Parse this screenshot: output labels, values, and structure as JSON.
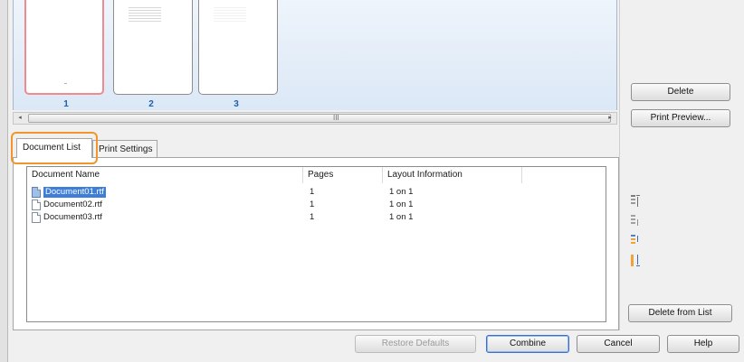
{
  "thumbnails": [
    {
      "number": "1",
      "selected": true
    },
    {
      "number": "2",
      "selected": false
    },
    {
      "number": "3",
      "selected": false
    }
  ],
  "preview_buttons": {
    "delete": "Delete",
    "print_preview": "Print Preview..."
  },
  "scrollbar": {
    "left_arrow": "◂",
    "grip": "III",
    "right_arrow": "▸"
  },
  "tabs": [
    {
      "label": "Document List",
      "active": true
    },
    {
      "label": "Print Settings",
      "active": false
    }
  ],
  "document_list": {
    "columns": [
      "Document Name",
      "Pages",
      "Layout Information"
    ],
    "rows": [
      {
        "name": "Document01.rtf",
        "pages": "1",
        "layout": "1 on 1",
        "selected": true
      },
      {
        "name": "Document02.rtf",
        "pages": "1",
        "layout": "1 on 1",
        "selected": false
      },
      {
        "name": "Document03.rtf",
        "pages": "1",
        "layout": "1 on 1",
        "selected": false
      }
    ]
  },
  "order_tools": [
    "move-to-top-icon",
    "move-up-icon",
    "move-down-icon",
    "move-to-bottom-icon"
  ],
  "list_buttons": {
    "delete_from_list": "Delete from List"
  },
  "footer_buttons": {
    "restore_defaults": "Restore Defaults",
    "combine": "Combine",
    "cancel": "Cancel",
    "help": "Help"
  },
  "colors": {
    "selection": "#3e7ed6",
    "highlight": "#f0962a",
    "thumb_selected": "#ef8a90",
    "page_number": "#1e5fa8"
  }
}
